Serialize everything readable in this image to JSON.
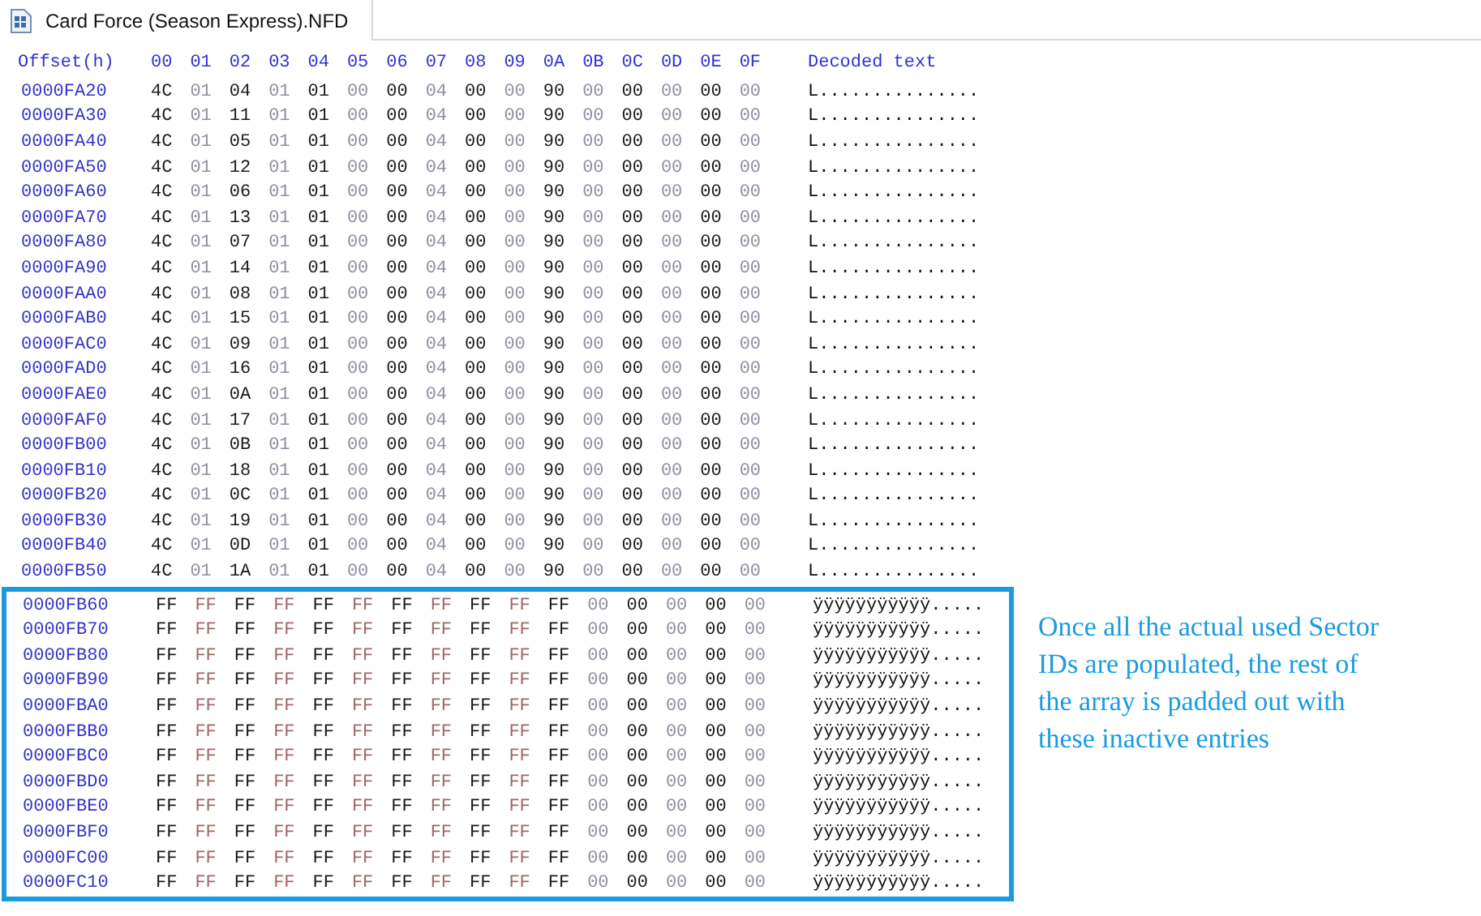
{
  "tab": {
    "title": "Card Force (Season Express).NFD",
    "selected": true
  },
  "columns": [
    "Offset(h)",
    "00",
    "01",
    "02",
    "03",
    "04",
    "05",
    "06",
    "07",
    "08",
    "09",
    "0A",
    "0B",
    "0C",
    "0D",
    "0E",
    "0F",
    "Decoded text"
  ],
  "rows": [
    {
      "offset": "0000FA20",
      "bytes": [
        "4C",
        "01",
        "04",
        "01",
        "01",
        "00",
        "00",
        "04",
        "00",
        "00",
        "90",
        "00",
        "00",
        "00",
        "00",
        "00"
      ],
      "decoded": "L...............",
      "highlighted": false
    },
    {
      "offset": "0000FA30",
      "bytes": [
        "4C",
        "01",
        "11",
        "01",
        "01",
        "00",
        "00",
        "04",
        "00",
        "00",
        "90",
        "00",
        "00",
        "00",
        "00",
        "00"
      ],
      "decoded": "L...............",
      "highlighted": false
    },
    {
      "offset": "0000FA40",
      "bytes": [
        "4C",
        "01",
        "05",
        "01",
        "01",
        "00",
        "00",
        "04",
        "00",
        "00",
        "90",
        "00",
        "00",
        "00",
        "00",
        "00"
      ],
      "decoded": "L...............",
      "highlighted": false
    },
    {
      "offset": "0000FA50",
      "bytes": [
        "4C",
        "01",
        "12",
        "01",
        "01",
        "00",
        "00",
        "04",
        "00",
        "00",
        "90",
        "00",
        "00",
        "00",
        "00",
        "00"
      ],
      "decoded": "L...............",
      "highlighted": false
    },
    {
      "offset": "0000FA60",
      "bytes": [
        "4C",
        "01",
        "06",
        "01",
        "01",
        "00",
        "00",
        "04",
        "00",
        "00",
        "90",
        "00",
        "00",
        "00",
        "00",
        "00"
      ],
      "decoded": "L...............",
      "highlighted": false
    },
    {
      "offset": "0000FA70",
      "bytes": [
        "4C",
        "01",
        "13",
        "01",
        "01",
        "00",
        "00",
        "04",
        "00",
        "00",
        "90",
        "00",
        "00",
        "00",
        "00",
        "00"
      ],
      "decoded": "L...............",
      "highlighted": false
    },
    {
      "offset": "0000FA80",
      "bytes": [
        "4C",
        "01",
        "07",
        "01",
        "01",
        "00",
        "00",
        "04",
        "00",
        "00",
        "90",
        "00",
        "00",
        "00",
        "00",
        "00"
      ],
      "decoded": "L...............",
      "highlighted": false
    },
    {
      "offset": "0000FA90",
      "bytes": [
        "4C",
        "01",
        "14",
        "01",
        "01",
        "00",
        "00",
        "04",
        "00",
        "00",
        "90",
        "00",
        "00",
        "00",
        "00",
        "00"
      ],
      "decoded": "L...............",
      "highlighted": false
    },
    {
      "offset": "0000FAA0",
      "bytes": [
        "4C",
        "01",
        "08",
        "01",
        "01",
        "00",
        "00",
        "04",
        "00",
        "00",
        "90",
        "00",
        "00",
        "00",
        "00",
        "00"
      ],
      "decoded": "L...............",
      "highlighted": false
    },
    {
      "offset": "0000FAB0",
      "bytes": [
        "4C",
        "01",
        "15",
        "01",
        "01",
        "00",
        "00",
        "04",
        "00",
        "00",
        "90",
        "00",
        "00",
        "00",
        "00",
        "00"
      ],
      "decoded": "L...............",
      "highlighted": false
    },
    {
      "offset": "0000FAC0",
      "bytes": [
        "4C",
        "01",
        "09",
        "01",
        "01",
        "00",
        "00",
        "04",
        "00",
        "00",
        "90",
        "00",
        "00",
        "00",
        "00",
        "00"
      ],
      "decoded": "L...............",
      "highlighted": false
    },
    {
      "offset": "0000FAD0",
      "bytes": [
        "4C",
        "01",
        "16",
        "01",
        "01",
        "00",
        "00",
        "04",
        "00",
        "00",
        "90",
        "00",
        "00",
        "00",
        "00",
        "00"
      ],
      "decoded": "L...............",
      "highlighted": false
    },
    {
      "offset": "0000FAE0",
      "bytes": [
        "4C",
        "01",
        "0A",
        "01",
        "01",
        "00",
        "00",
        "04",
        "00",
        "00",
        "90",
        "00",
        "00",
        "00",
        "00",
        "00"
      ],
      "decoded": "L...............",
      "highlighted": false
    },
    {
      "offset": "0000FAF0",
      "bytes": [
        "4C",
        "01",
        "17",
        "01",
        "01",
        "00",
        "00",
        "04",
        "00",
        "00",
        "90",
        "00",
        "00",
        "00",
        "00",
        "00"
      ],
      "decoded": "L...............",
      "highlighted": false
    },
    {
      "offset": "0000FB00",
      "bytes": [
        "4C",
        "01",
        "0B",
        "01",
        "01",
        "00",
        "00",
        "04",
        "00",
        "00",
        "90",
        "00",
        "00",
        "00",
        "00",
        "00"
      ],
      "decoded": "L...............",
      "highlighted": false
    },
    {
      "offset": "0000FB10",
      "bytes": [
        "4C",
        "01",
        "18",
        "01",
        "01",
        "00",
        "00",
        "04",
        "00",
        "00",
        "90",
        "00",
        "00",
        "00",
        "00",
        "00"
      ],
      "decoded": "L...............",
      "highlighted": false
    },
    {
      "offset": "0000FB20",
      "bytes": [
        "4C",
        "01",
        "0C",
        "01",
        "01",
        "00",
        "00",
        "04",
        "00",
        "00",
        "90",
        "00",
        "00",
        "00",
        "00",
        "00"
      ],
      "decoded": "L...............",
      "highlighted": false
    },
    {
      "offset": "0000FB30",
      "bytes": [
        "4C",
        "01",
        "19",
        "01",
        "01",
        "00",
        "00",
        "04",
        "00",
        "00",
        "90",
        "00",
        "00",
        "00",
        "00",
        "00"
      ],
      "decoded": "L...............",
      "highlighted": false
    },
    {
      "offset": "0000FB40",
      "bytes": [
        "4C",
        "01",
        "0D",
        "01",
        "01",
        "00",
        "00",
        "04",
        "00",
        "00",
        "90",
        "00",
        "00",
        "00",
        "00",
        "00"
      ],
      "decoded": "L...............",
      "highlighted": false
    },
    {
      "offset": "0000FB50",
      "bytes": [
        "4C",
        "01",
        "1A",
        "01",
        "01",
        "00",
        "00",
        "04",
        "00",
        "00",
        "90",
        "00",
        "00",
        "00",
        "00",
        "00"
      ],
      "decoded": "L...............",
      "highlighted": false
    },
    {
      "offset": "0000FB60",
      "bytes": [
        "FF",
        "FF",
        "FF",
        "FF",
        "FF",
        "FF",
        "FF",
        "FF",
        "FF",
        "FF",
        "FF",
        "00",
        "00",
        "00",
        "00",
        "00"
      ],
      "decoded": "ÿÿÿÿÿÿÿÿÿÿÿ.....",
      "highlighted": true
    },
    {
      "offset": "0000FB70",
      "bytes": [
        "FF",
        "FF",
        "FF",
        "FF",
        "FF",
        "FF",
        "FF",
        "FF",
        "FF",
        "FF",
        "FF",
        "00",
        "00",
        "00",
        "00",
        "00"
      ],
      "decoded": "ÿÿÿÿÿÿÿÿÿÿÿ.....",
      "highlighted": true
    },
    {
      "offset": "0000FB80",
      "bytes": [
        "FF",
        "FF",
        "FF",
        "FF",
        "FF",
        "FF",
        "FF",
        "FF",
        "FF",
        "FF",
        "FF",
        "00",
        "00",
        "00",
        "00",
        "00"
      ],
      "decoded": "ÿÿÿÿÿÿÿÿÿÿÿ.....",
      "highlighted": true
    },
    {
      "offset": "0000FB90",
      "bytes": [
        "FF",
        "FF",
        "FF",
        "FF",
        "FF",
        "FF",
        "FF",
        "FF",
        "FF",
        "FF",
        "FF",
        "00",
        "00",
        "00",
        "00",
        "00"
      ],
      "decoded": "ÿÿÿÿÿÿÿÿÿÿÿ.....",
      "highlighted": true
    },
    {
      "offset": "0000FBA0",
      "bytes": [
        "FF",
        "FF",
        "FF",
        "FF",
        "FF",
        "FF",
        "FF",
        "FF",
        "FF",
        "FF",
        "FF",
        "00",
        "00",
        "00",
        "00",
        "00"
      ],
      "decoded": "ÿÿÿÿÿÿÿÿÿÿÿ.....",
      "highlighted": true
    },
    {
      "offset": "0000FBB0",
      "bytes": [
        "FF",
        "FF",
        "FF",
        "FF",
        "FF",
        "FF",
        "FF",
        "FF",
        "FF",
        "FF",
        "FF",
        "00",
        "00",
        "00",
        "00",
        "00"
      ],
      "decoded": "ÿÿÿÿÿÿÿÿÿÿÿ.....",
      "highlighted": true
    },
    {
      "offset": "0000FBC0",
      "bytes": [
        "FF",
        "FF",
        "FF",
        "FF",
        "FF",
        "FF",
        "FF",
        "FF",
        "FF",
        "FF",
        "FF",
        "00",
        "00",
        "00",
        "00",
        "00"
      ],
      "decoded": "ÿÿÿÿÿÿÿÿÿÿÿ.....",
      "highlighted": true
    },
    {
      "offset": "0000FBD0",
      "bytes": [
        "FF",
        "FF",
        "FF",
        "FF",
        "FF",
        "FF",
        "FF",
        "FF",
        "FF",
        "FF",
        "FF",
        "00",
        "00",
        "00",
        "00",
        "00"
      ],
      "decoded": "ÿÿÿÿÿÿÿÿÿÿÿ.....",
      "highlighted": true
    },
    {
      "offset": "0000FBE0",
      "bytes": [
        "FF",
        "FF",
        "FF",
        "FF",
        "FF",
        "FF",
        "FF",
        "FF",
        "FF",
        "FF",
        "FF",
        "00",
        "00",
        "00",
        "00",
        "00"
      ],
      "decoded": "ÿÿÿÿÿÿÿÿÿÿÿ.....",
      "highlighted": true
    },
    {
      "offset": "0000FBF0",
      "bytes": [
        "FF",
        "FF",
        "FF",
        "FF",
        "FF",
        "FF",
        "FF",
        "FF",
        "FF",
        "FF",
        "FF",
        "00",
        "00",
        "00",
        "00",
        "00"
      ],
      "decoded": "ÿÿÿÿÿÿÿÿÿÿÿ.....",
      "highlighted": true
    },
    {
      "offset": "0000FC00",
      "bytes": [
        "FF",
        "FF",
        "FF",
        "FF",
        "FF",
        "FF",
        "FF",
        "FF",
        "FF",
        "FF",
        "FF",
        "00",
        "00",
        "00",
        "00",
        "00"
      ],
      "decoded": "ÿÿÿÿÿÿÿÿÿÿÿ.....",
      "highlighted": true
    },
    {
      "offset": "0000FC10",
      "bytes": [
        "FF",
        "FF",
        "FF",
        "FF",
        "FF",
        "FF",
        "FF",
        "FF",
        "FF",
        "FF",
        "FF",
        "00",
        "00",
        "00",
        "00",
        "00"
      ],
      "decoded": "ÿÿÿÿÿÿÿÿÿÿÿ.....",
      "highlighted": true
    }
  ],
  "annotation": "Once all the actual used Sector IDs are populated, the rest of the array is padded out with these inactive entries"
}
